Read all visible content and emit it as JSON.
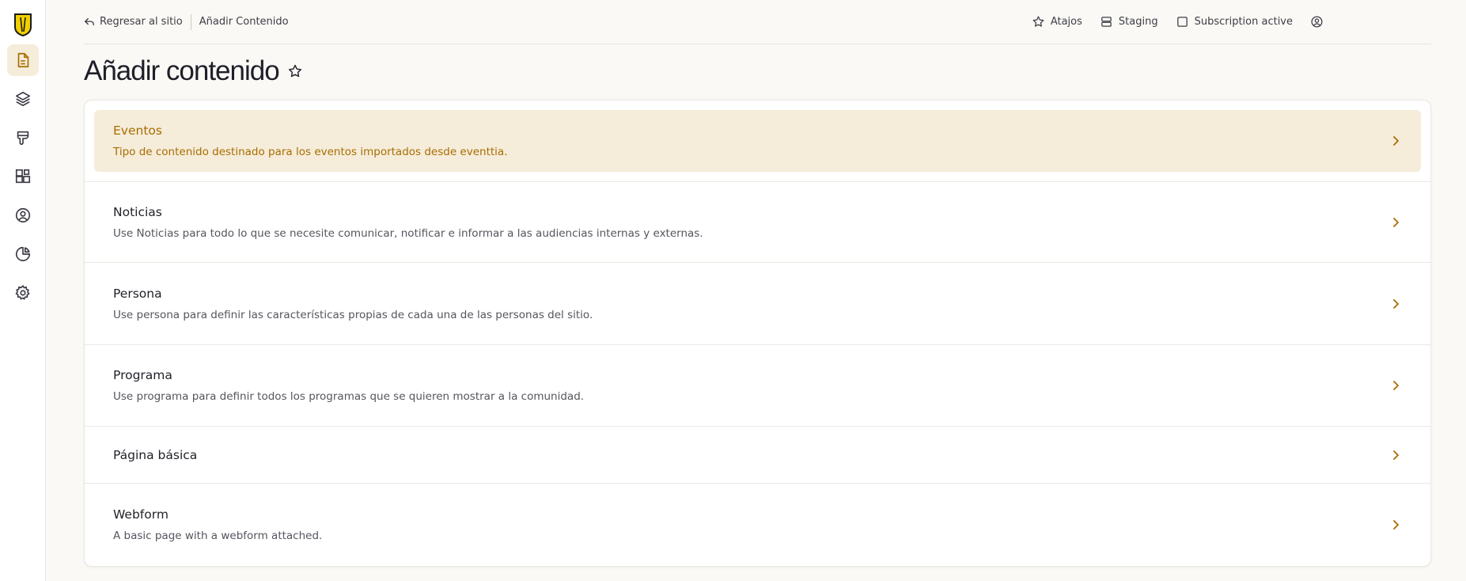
{
  "sidebar": {
    "logo": "university-shield-logo",
    "items": [
      {
        "name": "content",
        "icon": "document-icon",
        "active": true
      },
      {
        "name": "structure",
        "icon": "layers-icon",
        "active": false
      },
      {
        "name": "appearance",
        "icon": "brush-icon",
        "active": false
      },
      {
        "name": "extend",
        "icon": "blocks-icon",
        "active": false
      },
      {
        "name": "people",
        "icon": "user-circle-icon",
        "active": false
      },
      {
        "name": "reports",
        "icon": "pie-chart-icon",
        "active": false
      },
      {
        "name": "configuration",
        "icon": "gear-icon",
        "active": false
      }
    ]
  },
  "topbar": {
    "back_label": "Regresar al sitio",
    "breadcrumb_current": "Añadir Contenido",
    "shortcuts_label": "Atajos",
    "staging_label": "Staging",
    "subscription_label": "Subscription active"
  },
  "page": {
    "title": "Añadir contenido"
  },
  "content_types": [
    {
      "title": "Eventos",
      "description": "Tipo de contenido destinado para los eventos importados desde eventtia."
    },
    {
      "title": "Noticias",
      "description": "Use Noticias para todo lo que se necesite comunicar, notificar e informar a las audiencias internas y externas."
    },
    {
      "title": "Persona",
      "description": "Use persona para definir las características propias de cada una de las personas del sitio."
    },
    {
      "title": "Programa",
      "description": "Use programa para definir todos los programas que se quieren mostrar a la comunidad."
    },
    {
      "title": "Página básica",
      "description": ""
    },
    {
      "title": "Webform",
      "description": "A basic page with a webform attached."
    }
  ],
  "colors": {
    "accent": "#a86d00",
    "highlight_bg": "#f5ecda",
    "page_bg": "#fbf9f5"
  }
}
